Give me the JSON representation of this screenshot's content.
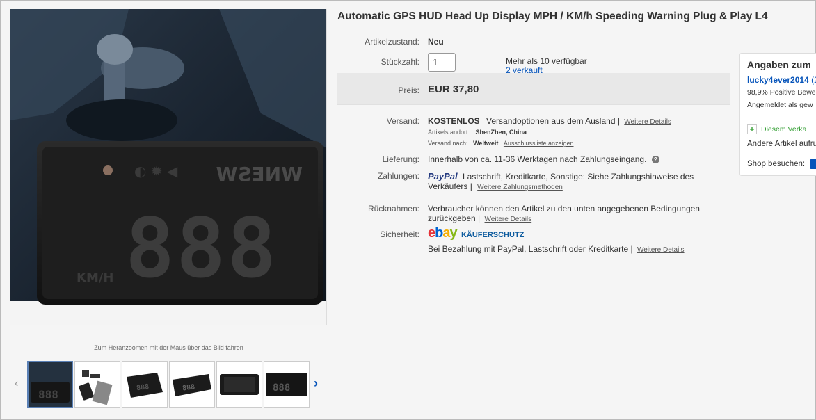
{
  "title": "Automatic GPS HUD Head Up Display MPH / KM/h Speeding Warning Plug & Play L4",
  "image": {
    "zoom_hint": "Zum Heranzoomen mit der Maus über das Bild fahren",
    "hud_text": "WNESW",
    "digits": "888",
    "unit": "KM/H"
  },
  "thumbnails": {
    "prev": "‹",
    "next": "›",
    "count": 6
  },
  "condition": {
    "label": "Artikelzustand:",
    "value": "Neu"
  },
  "quantity": {
    "label": "Stückzahl:",
    "value": "1",
    "available": "Mehr als 10 verfügbar",
    "sold": "2 verkauft"
  },
  "price": {
    "label": "Preis:",
    "value": "EUR 37,80"
  },
  "shipping": {
    "label": "Versand:",
    "value": "KOSTENLOS",
    "options": "Versandoptionen aus dem Ausland |",
    "details_link": "Weitere Details",
    "location_label": "Artikelstandort:",
    "location": "ShenZhen, China",
    "ships_to_label": "Versand nach:",
    "ships_to": "Weltweit",
    "exclusions_link": "Ausschlussliste anzeigen"
  },
  "delivery": {
    "label": "Lieferung:",
    "value": "Innerhalb von ca. 11-36 Werktagen nach Zahlungseingang.",
    "help_icon": "?"
  },
  "payments": {
    "label": "Zahlungen:",
    "paypal": "PayPal",
    "methods": "Lastschrift,  Kreditkarte,  Sonstige: Siehe Zahlungshinweise des",
    "methods2": "Verkäufers  |",
    "more_link": "Weitere Zahlungsmethoden"
  },
  "returns": {
    "label": "Rücknahmen:",
    "value": "Verbraucher können den Artikel zu den unten angegebenen Bedingungen",
    "value2": "zurückgeben |",
    "details_link": "Weitere Details"
  },
  "security": {
    "label": "Sicherheit:",
    "ebay": "ebay",
    "protection": "KÄUFERSCHUTZ",
    "value": "Bei Bezahlung mit PayPal, Lastschrift oder Kreditkarte |",
    "details_link": "Weitere Details"
  },
  "seller": {
    "header": "Angaben zum",
    "name": "lucky4ever2014",
    "name_suffix": "(2",
    "feedback": "98,9% Positive Bewe",
    "status": "Angemeldet als gew",
    "follow": "Diesem Verkä",
    "other_items": "Andere Artikel aufru",
    "shop_label": "Shop besuchen:"
  },
  "colors": {
    "link": "#0654ba",
    "price_bar": "#e8e8e8",
    "paypal_dark": "#253b80",
    "paypal_light": "#179bd7",
    "follow_plus": "#2c9b2c"
  }
}
